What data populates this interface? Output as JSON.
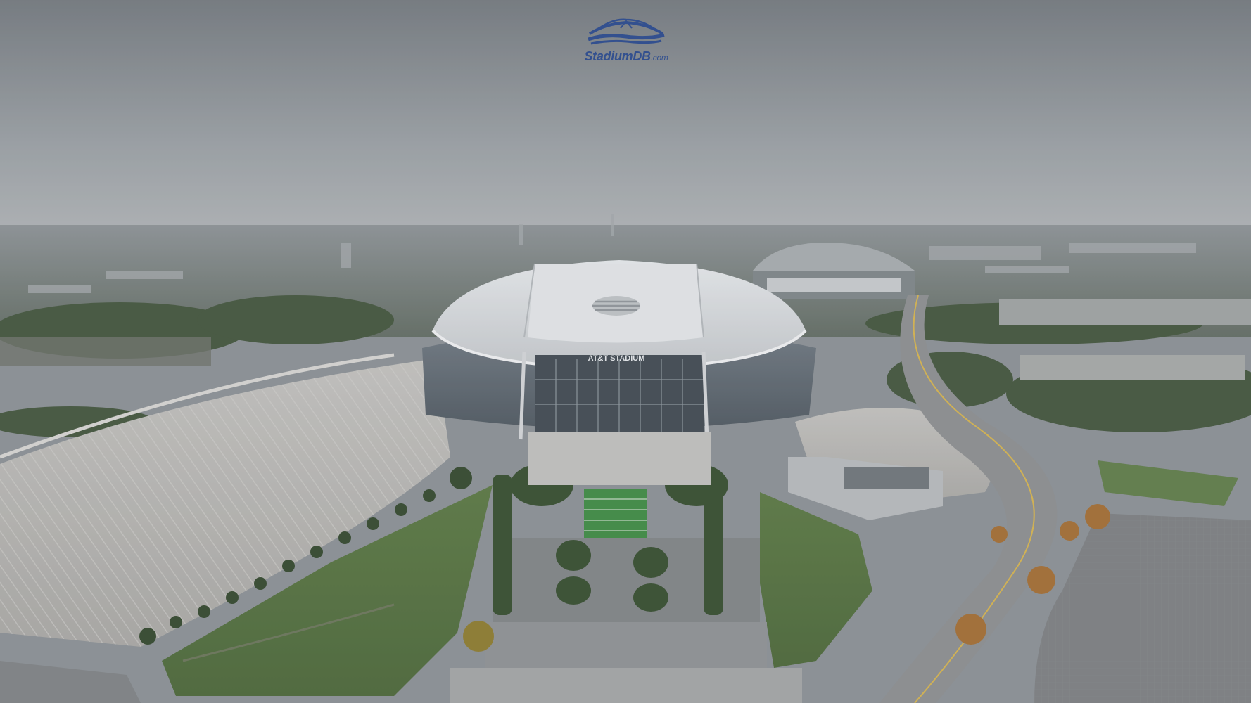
{
  "image": {
    "kind": "aerial photograph",
    "subject": "stadium with surrounding parking lots, lawns and roads",
    "sky": "overcast, grey haze",
    "colors": {
      "sky_top": "#7d8388",
      "sky_bottom": "#a9aeb1",
      "roof": "#dfe3e6",
      "facade_glass": "#59646d",
      "lawn": "#4f6e3a",
      "parking": "#bdbcb8",
      "watermark": "#33508f"
    }
  },
  "watermark": {
    "name": "StadiumDB",
    "suffix": ".com"
  },
  "stadium": {
    "facade_sign": "AT&T STADIUM",
    "roof_logo": "globe-logo"
  }
}
